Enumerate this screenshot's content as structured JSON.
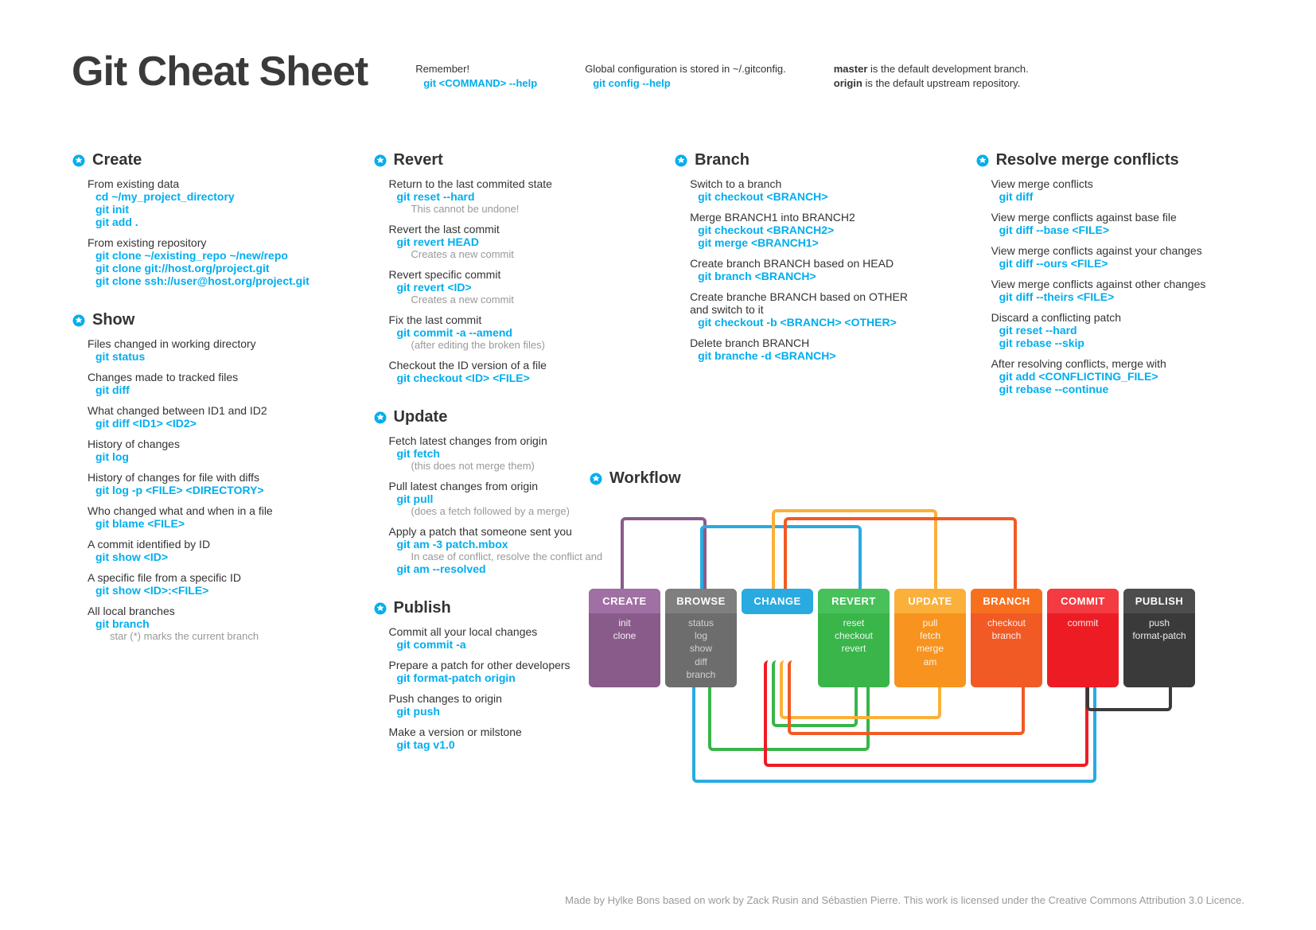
{
  "title": "Git Cheat Sheet",
  "header_notes": {
    "remember_label": "Remember!",
    "remember_cmd": "git <COMMAND> --help",
    "global_label": "Global configuration is stored in ~/.gitconfig.",
    "global_cmd": "git config --help",
    "master_b": "master",
    "master_rest": " is the default development branch.",
    "origin_b": "origin",
    "origin_rest": " is the default upstream repository."
  },
  "sections": {
    "create": {
      "title": "Create",
      "a_desc": "From existing data",
      "a_c1": "cd ~/my_project_directory",
      "a_c2": "git init",
      "a_c3": "git add .",
      "b_desc": "From existing repository",
      "b_c1": "git clone ~/existing_repo ~/new/repo",
      "b_c2": "git clone git://host.org/project.git",
      "b_c3": "git clone ssh://user@host.org/project.git"
    },
    "show": {
      "title": "Show",
      "a_desc": "Files changed in working directory",
      "a_c": "git status",
      "b_desc": "Changes made to tracked files",
      "b_c": "git diff",
      "c_desc": "What changed between ID1 and ID2",
      "c_c": "git diff <ID1> <ID2>",
      "d_desc": "History of changes",
      "d_c": "git log",
      "e_desc": "History of changes for file with diffs",
      "e_c": "git log -p <FILE> <DIRECTORY>",
      "f_desc": "Who changed what and when in a file",
      "f_c": "git blame <FILE>",
      "g_desc": "A commit identified by ID",
      "g_c": "git show <ID>",
      "h_desc": "A specific file from a specific ID",
      "h_c": "git show <ID>:<FILE>",
      "i_desc": "All local branches",
      "i_c": "git branch",
      "i_note": "star (*) marks the current branch"
    },
    "revert": {
      "title": "Revert",
      "a_desc": "Return to the last commited state",
      "a_c": "git reset --hard",
      "a_note": "This cannot be undone!",
      "b_desc": "Revert the last commit",
      "b_c": "git revert HEAD",
      "b_note": "Creates a new commit",
      "c_desc": "Revert specific commit",
      "c_c": "git revert <ID>",
      "c_note": "Creates a new commit",
      "d_desc": "Fix the last commit",
      "d_c": "git commit -a --amend",
      "d_note": "(after editing the broken files)",
      "e_desc": "Checkout the ID version of a file",
      "e_c": "git checkout <ID> <FILE>"
    },
    "update": {
      "title": "Update",
      "a_desc": "Fetch latest changes from origin",
      "a_c": "git fetch",
      "a_note": "(this does not merge them)",
      "b_desc": "Pull latest changes from origin",
      "b_c": "git pull",
      "b_note": "(does a fetch followed by a merge)",
      "c_desc": "Apply a patch that someone sent you",
      "c_c": "git am -3 patch.mbox",
      "c_note": "In case of conflict, resolve the conflict and",
      "c_c2": "git am --resolved"
    },
    "publish": {
      "title": "Publish",
      "a_desc": "Commit all your local changes",
      "a_c": "git commit -a",
      "b_desc": "Prepare a patch for other developers",
      "b_c": "git format-patch origin",
      "c_desc": "Push changes to origin",
      "c_c": "git push",
      "d_desc": "Make a version or milstone",
      "d_c": "git tag v1.0"
    },
    "branch": {
      "title": "Branch",
      "a_desc": "Switch to a branch",
      "a_c": "git checkout <BRANCH>",
      "b_desc": "Merge BRANCH1 into BRANCH2",
      "b_c1": "git checkout <BRANCH2>",
      "b_c2": "git merge <BRANCH1>",
      "c_desc": "Create branch BRANCH based on HEAD",
      "c_c": "git branch <BRANCH>",
      "d_desc": "Create branche BRANCH based on OTHER and switch to it",
      "d_c": "git checkout -b <BRANCH> <OTHER>",
      "e_desc": "Delete branch BRANCH",
      "e_c": "git branche -d <BRANCH>"
    },
    "resolve": {
      "title": "Resolve merge conflicts",
      "a_desc": "View merge conflicts",
      "a_c": "git diff",
      "b_desc": "View merge conflicts against base file",
      "b_c": "git diff --base <FILE>",
      "c_desc": "View merge conflicts against your changes",
      "c_c": "git diff --ours <FILE>",
      "d_desc": "View merge conflicts against other changes",
      "d_c": "git diff --theirs <FILE>",
      "e_desc": "Discard a conflicting patch",
      "e_c1": "git reset --hard",
      "e_c2": "git rebase --skip",
      "f_desc": "After resolving conflicts, merge with",
      "f_c1": "git add <CONFLICTING_FILE>",
      "f_c2": "git rebase --continue"
    }
  },
  "workflow": {
    "title": "Workflow",
    "boxes": {
      "create": {
        "h": "CREATE",
        "b": "init\nclone"
      },
      "browse": {
        "h": "BROWSE",
        "b": "status\nlog\nshow\ndiff\nbranch"
      },
      "change": {
        "h": "CHANGE",
        "b": ""
      },
      "revert": {
        "h": "REVERT",
        "b": "reset\ncheckout\nrevert"
      },
      "update": {
        "h": "UPDATE",
        "b": "pull\nfetch\nmerge\nam"
      },
      "branch": {
        "h": "BRANCH",
        "b": "checkout\nbranch"
      },
      "commit": {
        "h": "COMMIT",
        "b": "commit"
      },
      "publish": {
        "h": "PUBLISH",
        "b": "push\nformat-patch"
      }
    }
  },
  "footer": "Made by Hylke Bons based on work by Zack Rusin and Sébastien Pierre. This work is licensed under the Creative Commons Attribution 3.0 Licence."
}
